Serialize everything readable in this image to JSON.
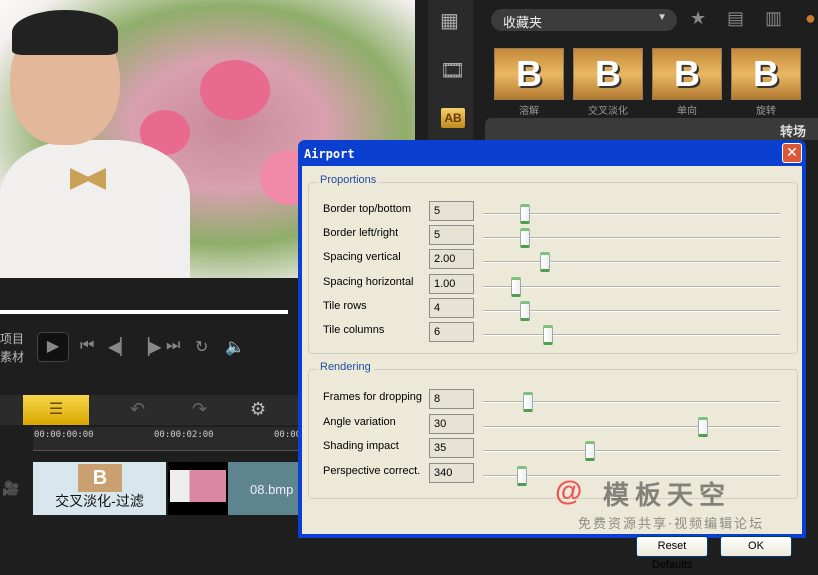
{
  "preview": {
    "mode_project": "项目",
    "mode_clip": "素材"
  },
  "library": {
    "folder": "收藏夹",
    "thumbs": [
      "溶解",
      "交叉淡化",
      "单向",
      "旋转"
    ],
    "thumb_glyph": "B",
    "section": "转场",
    "category_icon": "AB"
  },
  "timeline": {
    "timecodes": [
      "00:00:00:00",
      "00:00:02:00",
      "00:00"
    ],
    "clip_transition": "交叉淡化-过滤",
    "clip_image": "08.bmp"
  },
  "dialog": {
    "title": "Airport",
    "groups": [
      {
        "label": "Proportions",
        "params": [
          {
            "name": "Border top/bottom",
            "value": "5",
            "slider": 0.14
          },
          {
            "name": "Border left/right",
            "value": "5",
            "slider": 0.14
          },
          {
            "name": "Spacing vertical",
            "value": "2.00",
            "slider": 0.21
          },
          {
            "name": "Spacing horizontal",
            "value": "1.00",
            "slider": 0.11
          },
          {
            "name": "Tile rows",
            "value": "4",
            "slider": 0.14
          },
          {
            "name": "Tile columns",
            "value": "6",
            "slider": 0.22
          }
        ]
      },
      {
        "label": "Rendering",
        "params": [
          {
            "name": "Frames for dropping",
            "value": "8",
            "slider": 0.15
          },
          {
            "name": "Angle variation",
            "value": "30",
            "slider": 0.74
          },
          {
            "name": "Shading impact",
            "value": "35",
            "slider": 0.36
          },
          {
            "name": "Perspective correct.",
            "value": "340",
            "slider": 0.13
          }
        ]
      }
    ],
    "reset_label": "Reset Defaults",
    "ok_label": "OK"
  },
  "watermark": {
    "at": "@",
    "name": "模板天空",
    "slogan": "免费资源共享·视频编辑论坛"
  }
}
